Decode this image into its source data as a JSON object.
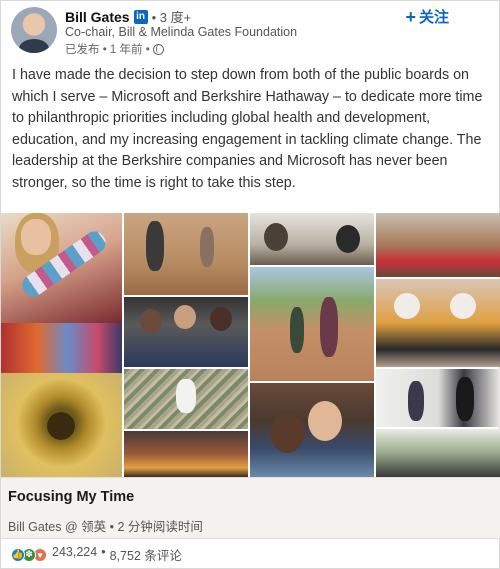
{
  "author": {
    "name": "Bill Gates",
    "network_badge": "in",
    "degree": "• 3 度+",
    "headline": "Co-chair, Bill & Melinda Gates Foundation",
    "posted_label": "已发布 • 1 年前 •"
  },
  "follow": {
    "label": "关注",
    "icon": "plus-icon"
  },
  "post": {
    "text": "I have made the decision to step down from both of the public boards on which I serve – Microsoft and Berkshire Hathaway – to dedicate more time to philanthropic priorities including global health and development, education, and my increasing engagement in tackling climate change. The leadership at the Berkshire companies and Microsoft has never been stronger, so the time is right to take this step."
  },
  "article": {
    "title": "Focusing My Time",
    "meta": "Bill Gates @ 领英 • 2 分钟阅读时间"
  },
  "social": {
    "reactions": "243,224",
    "separator": "•",
    "comments": "8,752 条评论"
  },
  "colors": {
    "accent": "#0a66c2",
    "article_bg": "#f3f2ef"
  }
}
